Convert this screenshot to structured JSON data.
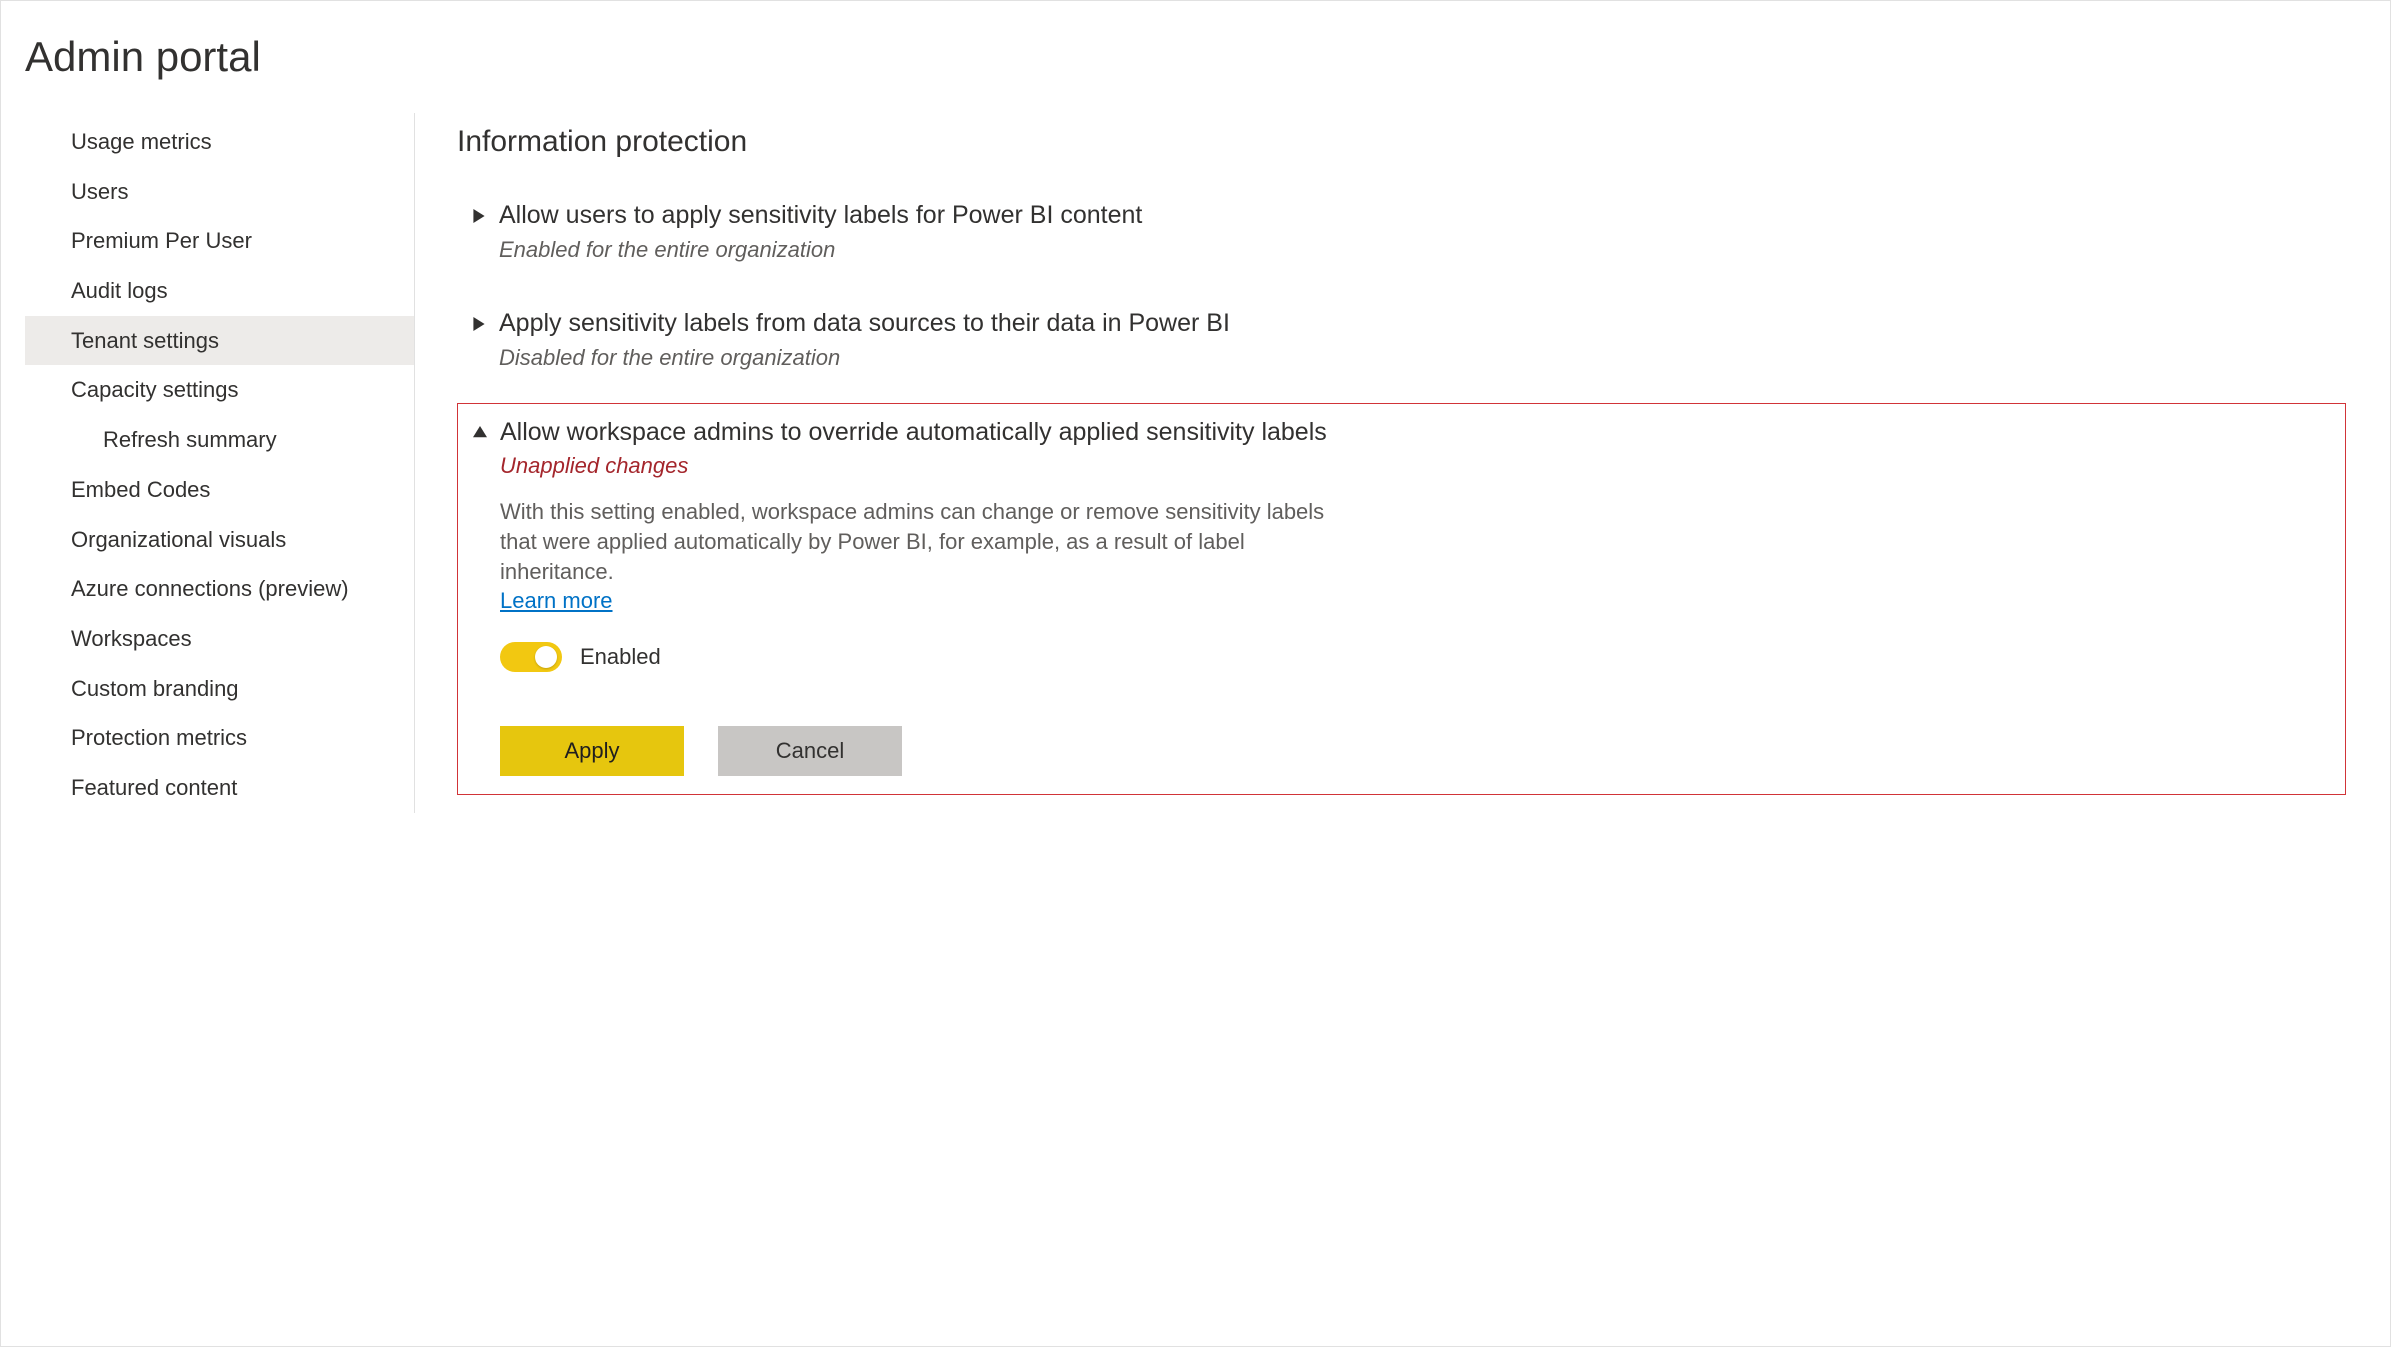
{
  "page": {
    "title": "Admin portal"
  },
  "sidebar": {
    "items": [
      {
        "id": "usage-metrics",
        "label": "Usage metrics",
        "indent": false,
        "selected": false
      },
      {
        "id": "users",
        "label": "Users",
        "indent": false,
        "selected": false
      },
      {
        "id": "premium-per-user",
        "label": "Premium Per User",
        "indent": false,
        "selected": false
      },
      {
        "id": "audit-logs",
        "label": "Audit logs",
        "indent": false,
        "selected": false
      },
      {
        "id": "tenant-settings",
        "label": "Tenant settings",
        "indent": false,
        "selected": true
      },
      {
        "id": "capacity-settings",
        "label": "Capacity settings",
        "indent": false,
        "selected": false
      },
      {
        "id": "refresh-summary",
        "label": "Refresh summary",
        "indent": true,
        "selected": false
      },
      {
        "id": "embed-codes",
        "label": "Embed Codes",
        "indent": false,
        "selected": false
      },
      {
        "id": "organizational-visuals",
        "label": "Organizational visuals",
        "indent": false,
        "selected": false
      },
      {
        "id": "azure-connections",
        "label": "Azure connections (preview)",
        "indent": false,
        "selected": false
      },
      {
        "id": "workspaces",
        "label": "Workspaces",
        "indent": false,
        "selected": false
      },
      {
        "id": "custom-branding",
        "label": "Custom branding",
        "indent": false,
        "selected": false
      },
      {
        "id": "protection-metrics",
        "label": "Protection metrics",
        "indent": false,
        "selected": false
      },
      {
        "id": "featured-content",
        "label": "Featured content",
        "indent": false,
        "selected": false
      }
    ]
  },
  "main": {
    "section_title": "Information protection",
    "settings": [
      {
        "id": "allow-sensitivity-labels",
        "title": "Allow users to apply sensitivity labels for Power BI content",
        "status_text": "Enabled for the entire organization",
        "highlight": false,
        "expanded": false
      },
      {
        "id": "apply-from-sources",
        "title": "Apply sensitivity labels from data sources to their data in Power BI",
        "status_text": "Disabled for the entire organization",
        "highlight": false,
        "expanded": false
      },
      {
        "id": "allow-admin-override",
        "title": "Allow workspace admins to override automatically applied sensitivity labels",
        "status_text": "Unapplied changes",
        "status_unapplied": true,
        "highlight": true,
        "expanded": true,
        "description": "With this setting enabled, workspace admins can change or remove sensitivity labels that were applied automatically by Power BI, for example, as a result of label inheritance.",
        "learn_more_label": "Learn more",
        "toggle": {
          "enabled": true,
          "label": "Enabled"
        },
        "buttons": {
          "apply": "Apply",
          "cancel": "Cancel"
        }
      }
    ]
  }
}
